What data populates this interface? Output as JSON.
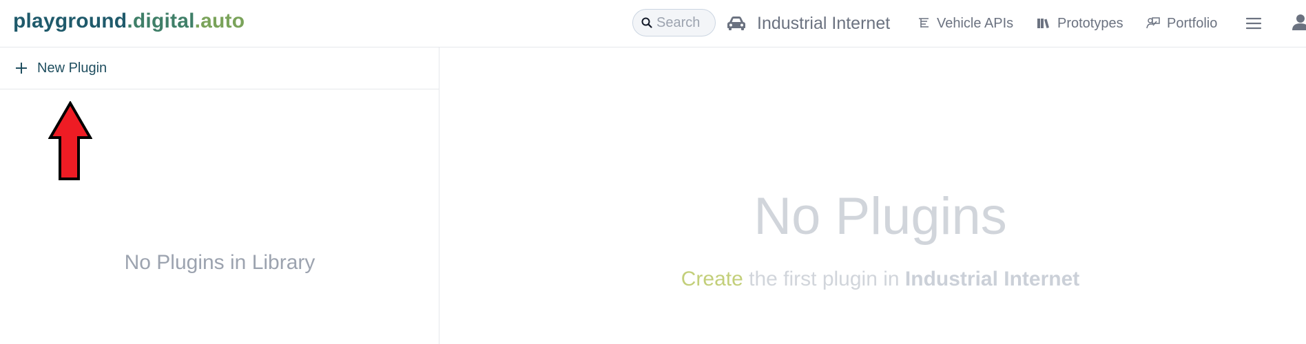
{
  "header": {
    "logo": {
      "part1": "playground",
      "part2": ".digital",
      "part3": ".auto"
    },
    "search": {
      "placeholder": "Search"
    },
    "model_name": "Industrial Internet",
    "nav": [
      {
        "label": "Vehicle APIs",
        "icon": "tree-list-icon"
      },
      {
        "label": "Prototypes",
        "icon": "library-icon"
      },
      {
        "label": "Portfolio",
        "icon": "presentation-icon"
      }
    ],
    "menu_icon": "hamburger-menu-icon",
    "user_icon": "user-icon"
  },
  "left_panel": {
    "new_plugin_label": "New Plugin",
    "empty_text": "No Plugins in Library",
    "annotation": {
      "icon": "red-up-arrow",
      "color": "#ee1c24"
    }
  },
  "main": {
    "title": "No Plugins",
    "create_link": "Create",
    "subtitle_middle": " the first plugin in ",
    "model_name": "Industrial Internet"
  },
  "colors": {
    "logo_dark": "#1f5a6b",
    "logo_mid": "#3f7f68",
    "logo_light": "#7aa35a",
    "create_accent": "#c3cf7a",
    "muted": "#9ca3af",
    "faint": "#d1d5db"
  }
}
